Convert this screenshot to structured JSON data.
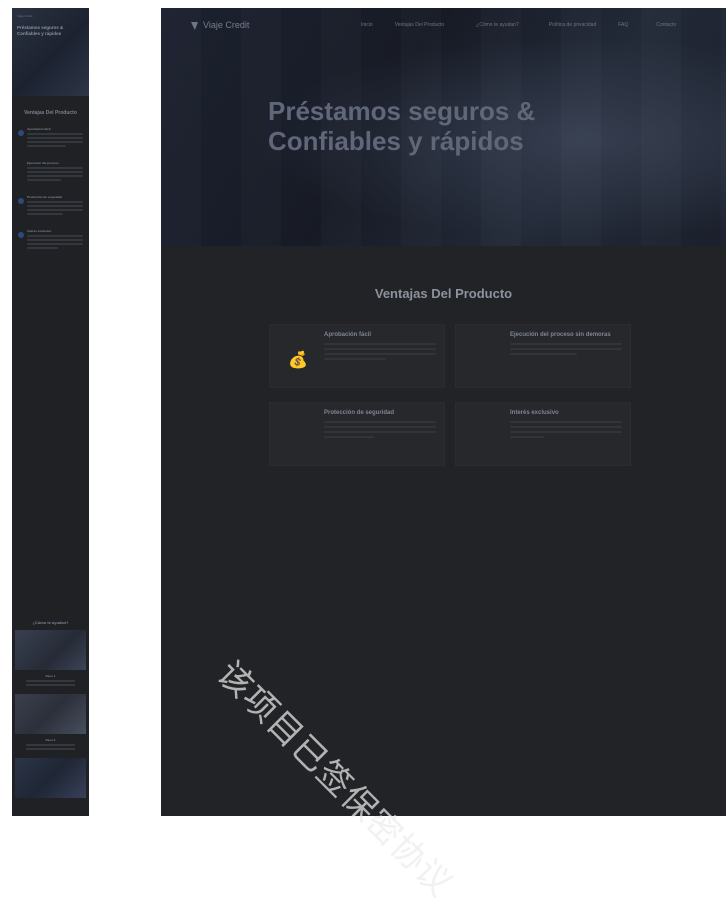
{
  "mobile": {
    "logo": "Viaje Credit",
    "hero_title": "Préstamos seguros & Confiables y rápidos",
    "hero_sub": "",
    "section_title": "Ventajas Del Producto",
    "features": [
      {
        "title": "Aprobación fácil"
      },
      {
        "title": "Ejecución del proceso"
      },
      {
        "title": "Protección de seguridad"
      },
      {
        "title": "Interés exclusivo"
      }
    ],
    "section2_title": "¿Cómo te ayudan?",
    "gallery": [
      {
        "caption": "Paso 1"
      },
      {
        "caption": "Paso 2"
      },
      {
        "caption": ""
      }
    ]
  },
  "desktop": {
    "logo_text": "Viaje Credit",
    "nav": [
      {
        "label": "Inicio"
      },
      {
        "label": "Ventajas Del Producto"
      },
      {
        "label": "¿Cómo te ayudan?"
      },
      {
        "label": "Política de privacidad"
      },
      {
        "label": "FAQ"
      },
      {
        "label": "Contacto"
      }
    ],
    "hero_title": "Préstamos seguros & Confiables y rápidos",
    "hero_sub": "",
    "benefits_title": "Ventajas Del Producto",
    "cards": [
      {
        "title": "Aprobación fácil",
        "icon": "bag-icon"
      },
      {
        "title": "Ejecución del proceso sin demoras",
        "icon": ""
      },
      {
        "title": "Protección de seguridad",
        "icon": ""
      },
      {
        "title": "Interés exclusivo",
        "icon": ""
      }
    ]
  },
  "watermark": "该项目已签保密协议"
}
